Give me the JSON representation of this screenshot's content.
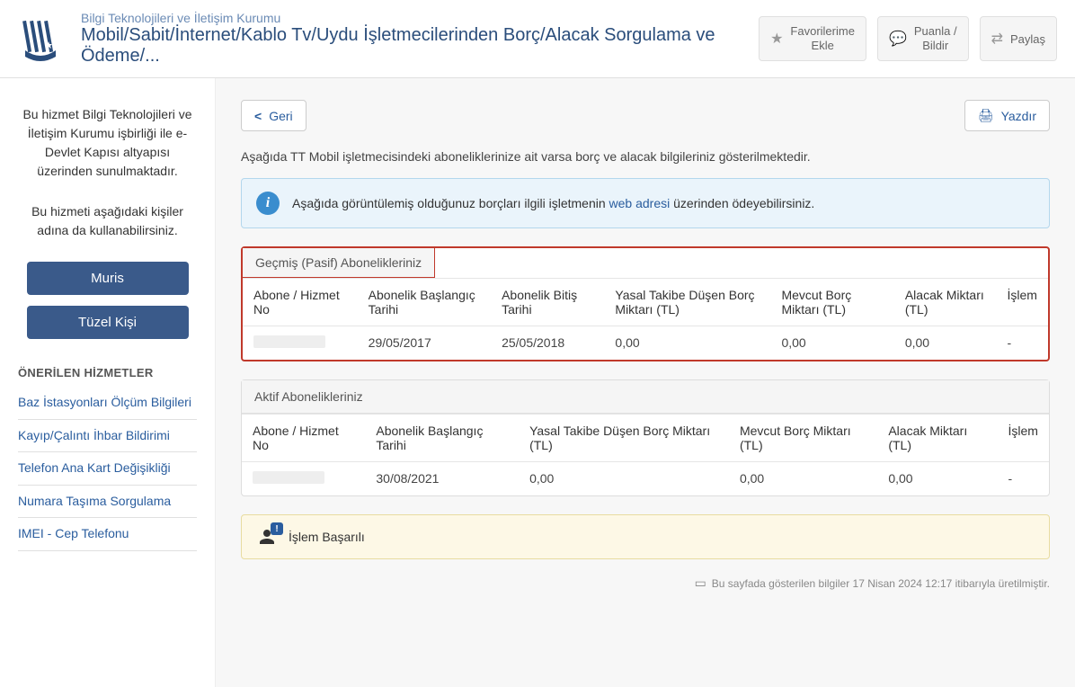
{
  "header": {
    "subtitle": "Bilgi Teknolojileri ve İletişim Kurumu",
    "title": "Mobil/Sabit/İnternet/Kablo Tv/Uydu İşletmecilerinden Borç/Alacak Sorgulama ve Ödeme/...",
    "actions": {
      "fav_l1": "Favorilerime",
      "fav_l2": "Ekle",
      "rate_l1": "Puanla /",
      "rate_l2": "Bildir",
      "share": "Paylaş"
    }
  },
  "sidebar": {
    "text1": "Bu hizmet Bilgi Teknolojileri ve İletişim Kurumu işbirliği ile e-Devlet Kapısı altyapısı üzerinden sunulmaktadır.",
    "text2": "Bu hizmeti aşağıdaki kişiler adına da kullanabilirsiniz.",
    "btn_muris": "Muris",
    "btn_tuzel": "Tüzel Kişi",
    "heading": "ÖNERİLEN HİZMETLER",
    "links": [
      "Baz İstasyonları Ölçüm Bilgileri",
      "Kayıp/Çalıntı İhbar Bildirimi",
      "Telefon Ana Kart Değişikliği",
      "Numara Taşıma Sorgulama",
      "IMEI - Cep Telefonu"
    ]
  },
  "toolbar": {
    "back": "Geri",
    "print": "Yazdır"
  },
  "description": "Aşağıda TT Mobil işletmecisindeki aboneliklerinize ait varsa borç ve alacak bilgileriniz gösterilmektedir.",
  "info": {
    "pre": "Aşağıda görüntülemiş olduğunuz borçları ilgili işletmenin ",
    "link": "web adresi",
    "post": " üzerinden ödeyebilirsiniz."
  },
  "table1": {
    "caption": "Geçmiş (Pasif) Abonelikleriniz",
    "headers": [
      "Abone / Hizmet No",
      "Abonelik Başlangıç Tarihi",
      "Abonelik Bitiş Tarihi",
      "Yasal Takibe Düşen Borç Miktarı (TL)",
      "Mevcut Borç Miktarı (TL)",
      "Alacak Miktarı (TL)",
      "İşlem"
    ],
    "row": {
      "c1": "29/05/2017",
      "c2": "25/05/2018",
      "c3": "0,00",
      "c4": "0,00",
      "c5": "0,00",
      "c6": "-"
    }
  },
  "table2": {
    "caption": "Aktif Abonelikleriniz",
    "headers": [
      "Abone / Hizmet No",
      "Abonelik Başlangıç Tarihi",
      "Yasal Takibe Düşen Borç Miktarı (TL)",
      "Mevcut Borç Miktarı (TL)",
      "Alacak Miktarı (TL)",
      "İşlem"
    ],
    "row": {
      "c1": "30/08/2021",
      "c2": "0,00",
      "c3": "0,00",
      "c4": "0,00",
      "c5": "-"
    }
  },
  "success": "İşlem Başarılı",
  "footer": "Bu sayfada gösterilen bilgiler 17 Nisan 2024 12:17 itibarıyla üretilmiştir."
}
